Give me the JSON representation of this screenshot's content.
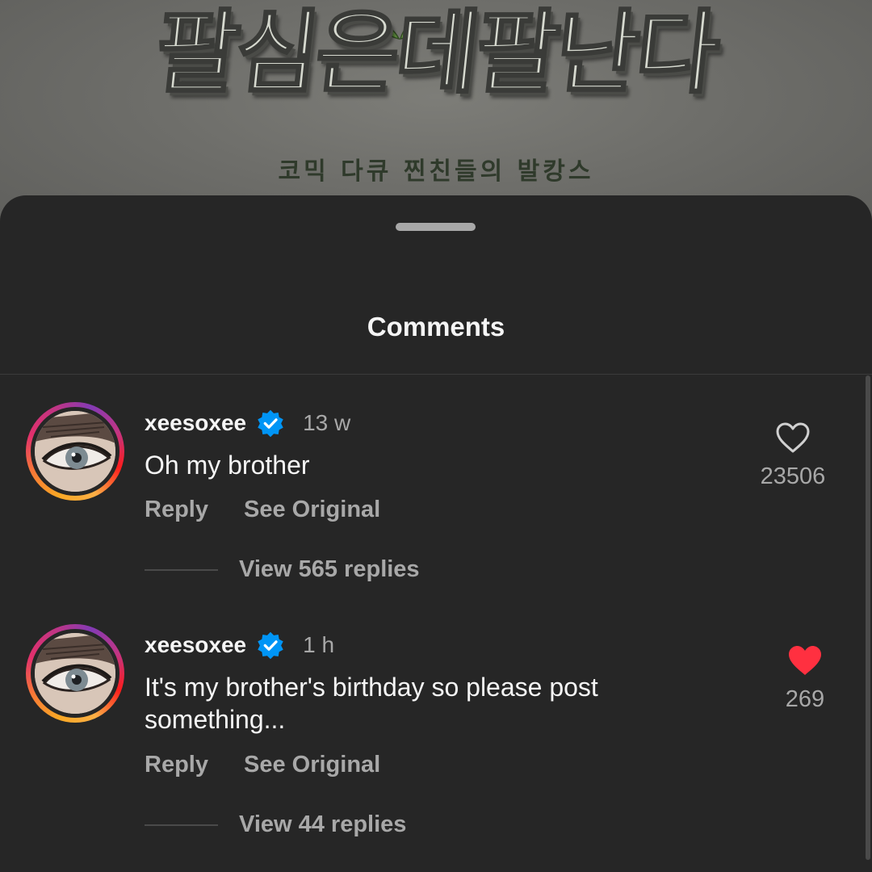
{
  "poster": {
    "title": "팔심은데팔난다",
    "subtitle": "코믹 다큐 찐친들의 발캉스"
  },
  "sheet": {
    "title": "Comments"
  },
  "comments": [
    {
      "username": "xeesoxee",
      "verified": true,
      "time": "13 w",
      "text": "Oh my brother",
      "reply_label": "Reply",
      "see_original_label": "See Original",
      "replies_label": "View 565 replies",
      "likes": "23506",
      "liked": false
    },
    {
      "username": "xeesoxee",
      "verified": true,
      "time": "1 h",
      "text": "It's my brother's birthday so please post something...",
      "reply_label": "Reply",
      "see_original_label": "See Original",
      "replies_label": "View 44 replies",
      "likes": "269",
      "liked": true
    }
  ],
  "colors": {
    "background": "#262626",
    "text_primary": "#f5f5f5",
    "text_secondary": "#a8a8a8",
    "verified_blue": "#0095f6",
    "heart_red": "#ff3040"
  },
  "icons": {
    "verified": "verified-badge-icon",
    "heart_outline": "heart-outline-icon",
    "heart_filled": "heart-filled-icon"
  }
}
